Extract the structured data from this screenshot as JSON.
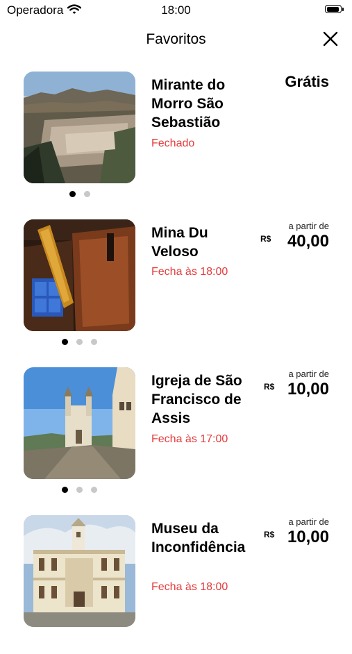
{
  "status_bar": {
    "carrier": "Operadora",
    "time": "18:00"
  },
  "header": {
    "title": "Favoritos",
    "close_icon": "close-icon"
  },
  "items": [
    {
      "name": "Mirante do Morro São Sebastião",
      "hours": "Fechado",
      "price_label": "Grátis",
      "pages": 2,
      "active_page": 1
    },
    {
      "name": "Mina Du Veloso",
      "hours": "Fecha às 18:00",
      "from_label": "a partir de",
      "currency": "R$",
      "price": "40,00",
      "pages": 3,
      "active_page": 1
    },
    {
      "name": "Igreja de São Francisco de Assis",
      "hours": "Fecha às 17:00",
      "from_label": "a partir de",
      "currency": "R$",
      "price": "10,00",
      "pages": 3,
      "active_page": 1
    },
    {
      "name": "Museu da Inconfidência",
      "hours": "Fecha às 18:00",
      "from_label": "a partir de",
      "currency": "R$",
      "price": "10,00"
    }
  ]
}
